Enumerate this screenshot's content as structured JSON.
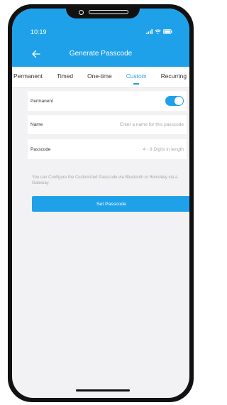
{
  "status": {
    "time": "10:19"
  },
  "nav": {
    "title": "Generate Passcode"
  },
  "tabs": [
    {
      "label": "Permanent"
    },
    {
      "label": "Timed"
    },
    {
      "label": "One-time"
    },
    {
      "label": "Custom"
    },
    {
      "label": "Recurring"
    }
  ],
  "form": {
    "permanent": {
      "label": "Permanent",
      "toggle_on": true
    },
    "name": {
      "label": "Name",
      "placeholder": "Enter a name for this passcode"
    },
    "passcode": {
      "label": "Passcode",
      "placeholder": "4 - 9 Digits in length"
    }
  },
  "hint": "You can Configure the Customized Passcode via Bluetooth or Remotely via a Gateway",
  "cta_label": "Set Passcode",
  "colors": {
    "accent": "#1fa1ea",
    "background": "#f2f2f4"
  }
}
